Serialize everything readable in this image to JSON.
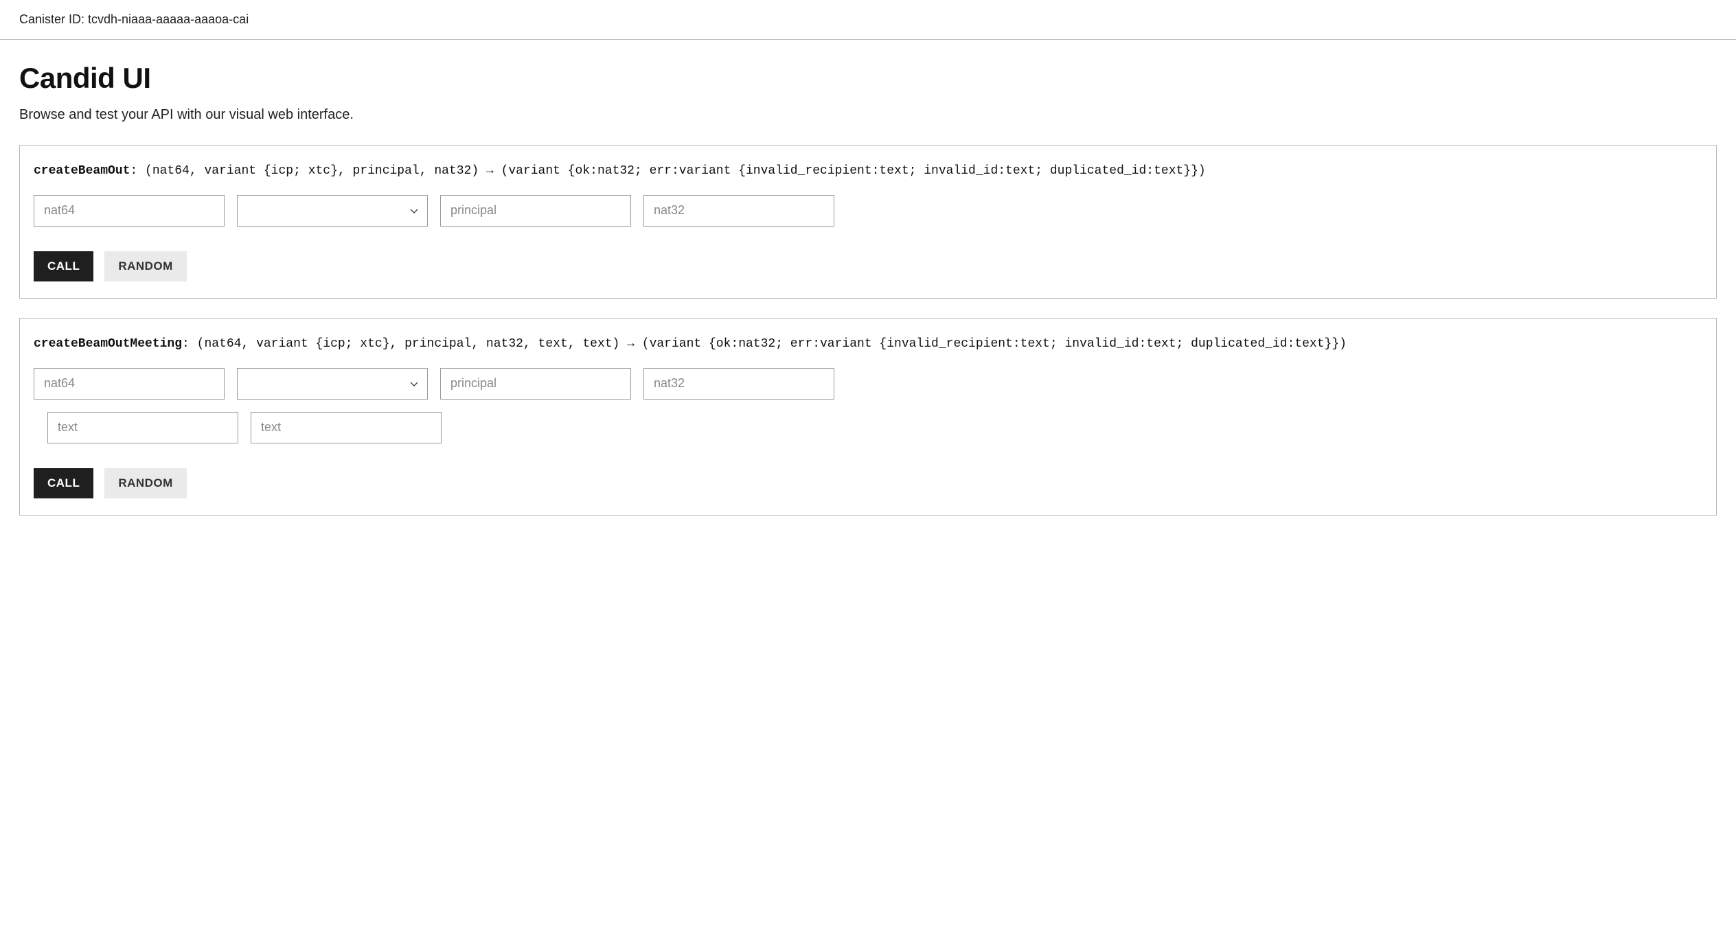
{
  "header": {
    "canister_label": "Canister ID: tcvdh-niaaa-aaaaa-aaaoa-cai"
  },
  "page": {
    "title": "Candid UI",
    "subtitle": "Browse and test your API with our visual web interface."
  },
  "buttons": {
    "call": "CALL",
    "random": "RANDOM"
  },
  "methods": [
    {
      "name": "createBeamOut",
      "signature_rest": " (nat64, variant {icp; xtc}, principal, nat32) → (variant {ok:nat32; err:variant {invalid_recipient:text; invalid_id:text; duplicated_id:text}})",
      "params_row1": [
        {
          "type": "input",
          "placeholder": "nat64"
        },
        {
          "type": "select",
          "placeholder": ""
        },
        {
          "type": "input",
          "placeholder": "principal"
        },
        {
          "type": "input",
          "placeholder": "nat32"
        }
      ],
      "params_row2": []
    },
    {
      "name": "createBeamOutMeeting",
      "signature_rest": " (nat64, variant {icp; xtc}, principal, nat32, text, text) → (variant {ok:nat32; err:variant {invalid_recipient:text; invalid_id:text; duplicated_id:text}})",
      "params_row1": [
        {
          "type": "input",
          "placeholder": "nat64"
        },
        {
          "type": "select",
          "placeholder": ""
        },
        {
          "type": "input",
          "placeholder": "principal"
        },
        {
          "type": "input",
          "placeholder": "nat32"
        }
      ],
      "params_row2": [
        {
          "type": "input",
          "placeholder": "text"
        },
        {
          "type": "input",
          "placeholder": "text"
        }
      ]
    }
  ]
}
